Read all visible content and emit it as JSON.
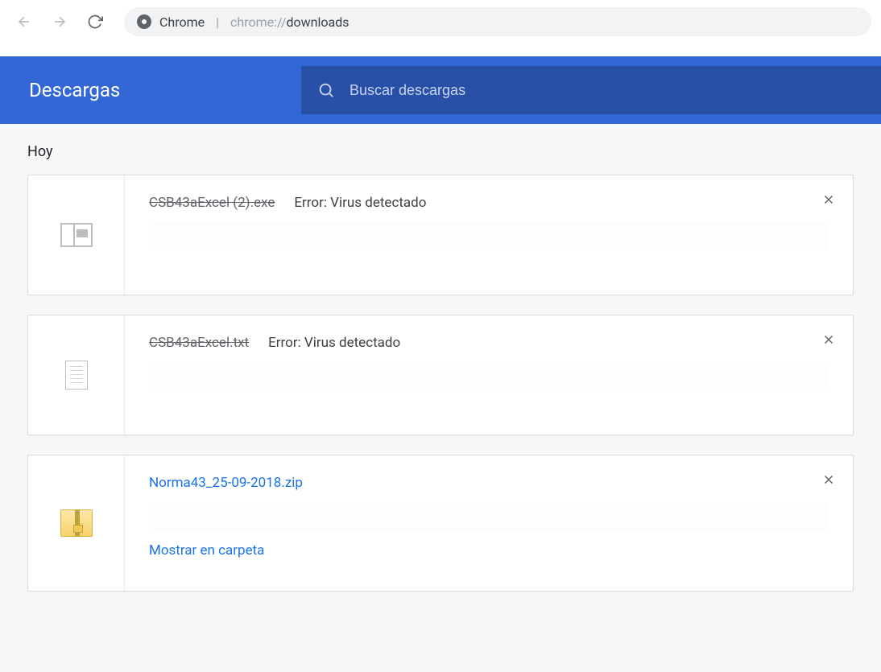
{
  "nav": {
    "browser_label": "Chrome",
    "url_prefix": "chrome://",
    "url_emph": "downloads"
  },
  "header": {
    "title": "Descargas",
    "search_placeholder": "Buscar descargas"
  },
  "section": {
    "day_label": "Hoy"
  },
  "downloads": [
    {
      "filename": "CSB43aExcel (2).exe",
      "status": "Error: Virus detectado",
      "blocked": true,
      "icon": "exe",
      "action": null
    },
    {
      "filename": "CSB43aExcel.txt",
      "status": "Error: Virus detectado",
      "blocked": true,
      "icon": "txt",
      "action": null
    },
    {
      "filename": "Norma43_25-09-2018.zip",
      "status": null,
      "blocked": false,
      "icon": "zip",
      "action": "Mostrar en carpeta"
    }
  ]
}
